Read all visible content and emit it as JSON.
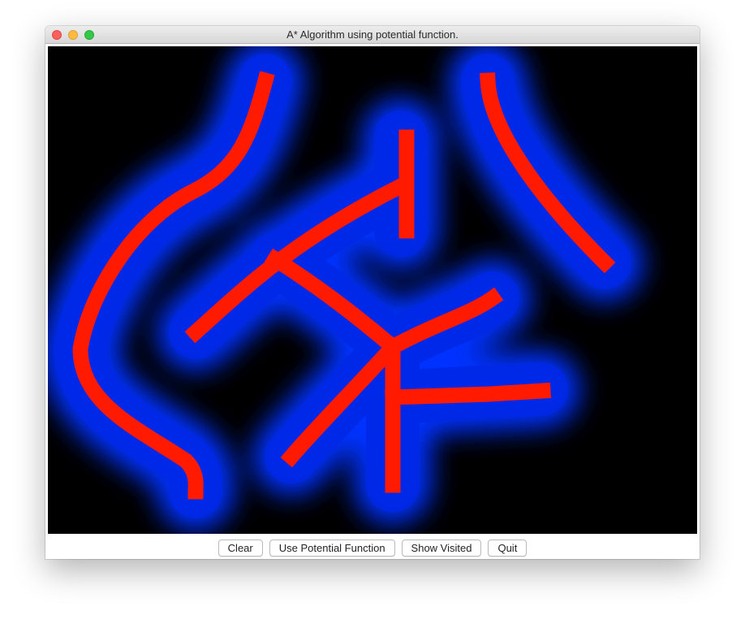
{
  "window": {
    "title": "A* Algorithm using potential function."
  },
  "canvas": {
    "background_color": "#000000",
    "obstacle_color": "#ff1a00",
    "potential_field_color": "#0033ff"
  },
  "buttons": {
    "clear": "Clear",
    "use_potential_function": "Use Potential Function",
    "show_visited": "Show Visited",
    "quit": "Quit"
  }
}
